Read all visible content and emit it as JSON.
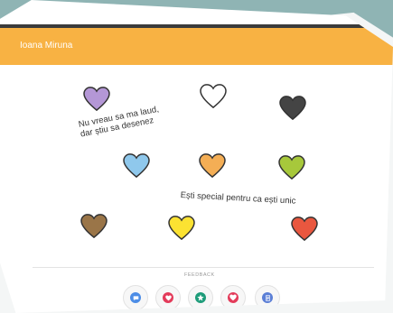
{
  "app": {
    "title": "Ioana Miruna",
    "bar_color": "#f8b243"
  },
  "hearts": [
    {
      "color": "#b497d6"
    },
    {
      "color": "#ffffff"
    },
    {
      "color": "#444444"
    },
    {
      "color": "#8fc8ec"
    },
    {
      "color": "#f4ae55"
    },
    {
      "color": "#a7c83b"
    },
    {
      "color": "#9a7548"
    },
    {
      "color": "#fbe232"
    },
    {
      "color": "#e9573f"
    }
  ],
  "captions": {
    "first": "Nu vreau sa ma laud,\ndar știu sa desenez",
    "second": "Ești special pentru ca ești unic"
  },
  "feedback": {
    "label": "FEEDBACK",
    "buttons": [
      {
        "icon": "chat-icon",
        "color": "#4d8de6"
      },
      {
        "icon": "heart-icon",
        "color": "#e33b5a"
      },
      {
        "icon": "star-icon",
        "color": "#1e9c7a"
      },
      {
        "icon": "heart-filled-icon",
        "color": "#e33b5a"
      },
      {
        "icon": "document-icon",
        "color": "#5b7fd6"
      }
    ]
  }
}
